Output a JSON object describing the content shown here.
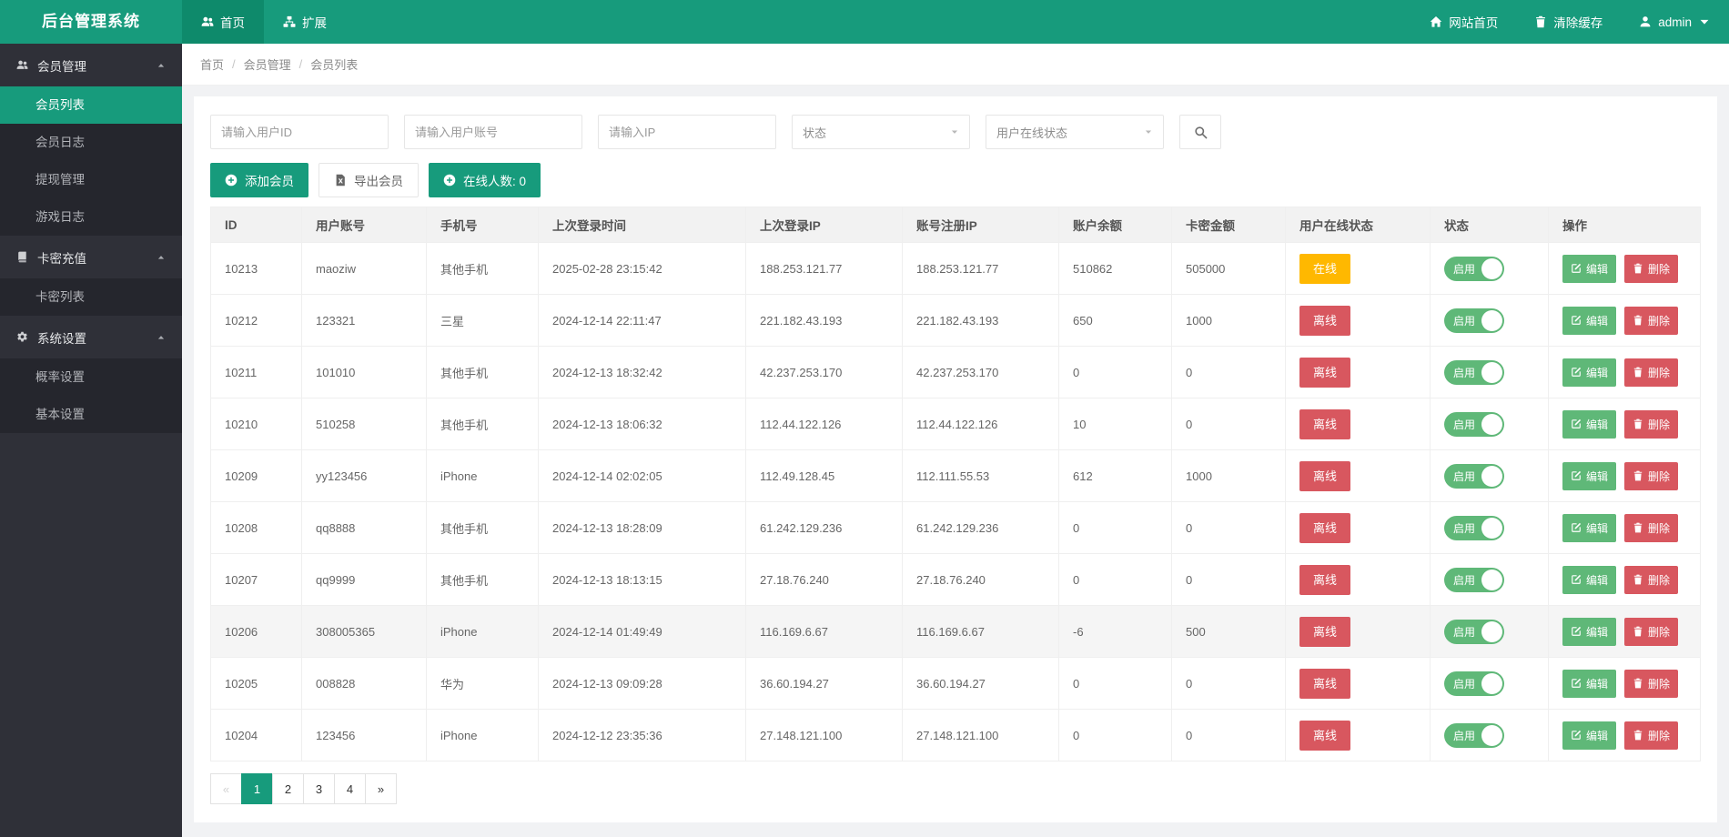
{
  "app": {
    "title": "后台管理系统"
  },
  "topnav": {
    "tabs": [
      {
        "name": "home",
        "label": "首页",
        "icon": "users-icon",
        "active": true
      },
      {
        "name": "extend",
        "label": "扩展",
        "icon": "sitemap-icon",
        "active": false
      }
    ],
    "right": [
      {
        "name": "site-home",
        "label": "网站首页",
        "icon": "home-icon",
        "caret": false
      },
      {
        "name": "clear-cache",
        "label": "清除缓存",
        "icon": "trash-icon",
        "caret": false
      },
      {
        "name": "admin-user",
        "label": "admin",
        "icon": "user-icon",
        "caret": true
      }
    ]
  },
  "sidebar": {
    "groups": [
      {
        "name": "member-management",
        "label": "会员管理",
        "icon": "users-icon",
        "expanded": true,
        "items": [
          {
            "name": "member-list",
            "label": "会员列表",
            "active": true
          },
          {
            "name": "member-log",
            "label": "会员日志",
            "active": false
          },
          {
            "name": "withdraw-management",
            "label": "提现管理",
            "active": false
          },
          {
            "name": "game-log",
            "label": "游戏日志",
            "active": false
          }
        ]
      },
      {
        "name": "card-recharge",
        "label": "卡密充值",
        "icon": "book-icon",
        "expanded": true,
        "items": [
          {
            "name": "card-list",
            "label": "卡密列表",
            "active": false
          }
        ]
      },
      {
        "name": "system-settings",
        "label": "系统设置",
        "icon": "gear-icon",
        "expanded": true,
        "items": [
          {
            "name": "probability-settings",
            "label": "概率设置",
            "active": false
          },
          {
            "name": "basic-settings",
            "label": "基本设置",
            "active": false
          }
        ]
      }
    ]
  },
  "breadcrumb": {
    "items": [
      "首页",
      "会员管理",
      "会员列表"
    ],
    "separator": "/"
  },
  "filters": {
    "inputs": [
      {
        "name": "user-id",
        "placeholder": "请输入用户ID",
        "value": ""
      },
      {
        "name": "user-account",
        "placeholder": "请输入用户账号",
        "value": ""
      },
      {
        "name": "ip",
        "placeholder": "请输入IP",
        "value": ""
      }
    ],
    "selects": [
      {
        "name": "status",
        "label": "状态"
      },
      {
        "name": "online-status",
        "label": "用户在线状态"
      }
    ]
  },
  "toolbar": {
    "add_label": "添加会员",
    "export_label": "导出会员",
    "online_count_label": "在线人数: 0"
  },
  "table": {
    "headers": [
      "ID",
      "用户账号",
      "手机号",
      "上次登录时间",
      "上次登录IP",
      "账号注册IP",
      "账户余额",
      "卡密金额",
      "用户在线状态",
      "状态",
      "操作"
    ],
    "online_badge": "在线",
    "offline_badge": "离线",
    "toggle_label": "启用",
    "edit_label": "编辑",
    "delete_label": "删除",
    "rows": [
      {
        "id": "10213",
        "account": "maoziw",
        "phone": "其他手机",
        "last_login_time": "2025-02-28 23:15:42",
        "last_login_ip": "188.253.121.77",
        "register_ip": "188.253.121.77",
        "balance": "510862",
        "card_amount": "505000",
        "online": true,
        "enabled": true,
        "highlight": false
      },
      {
        "id": "10212",
        "account": "123321",
        "phone": "三星",
        "last_login_time": "2024-12-14 22:11:47",
        "last_login_ip": "221.182.43.193",
        "register_ip": "221.182.43.193",
        "balance": "650",
        "card_amount": "1000",
        "online": false,
        "enabled": true,
        "highlight": false
      },
      {
        "id": "10211",
        "account": "101010",
        "phone": "其他手机",
        "last_login_time": "2024-12-13 18:32:42",
        "last_login_ip": "42.237.253.170",
        "register_ip": "42.237.253.170",
        "balance": "0",
        "card_amount": "0",
        "online": false,
        "enabled": true,
        "highlight": false
      },
      {
        "id": "10210",
        "account": "510258",
        "phone": "其他手机",
        "last_login_time": "2024-12-13 18:06:32",
        "last_login_ip": "112.44.122.126",
        "register_ip": "112.44.122.126",
        "balance": "10",
        "card_amount": "0",
        "online": false,
        "enabled": true,
        "highlight": false
      },
      {
        "id": "10209",
        "account": "yy123456",
        "phone": "iPhone",
        "last_login_time": "2024-12-14 02:02:05",
        "last_login_ip": "112.49.128.45",
        "register_ip": "112.111.55.53",
        "balance": "612",
        "card_amount": "1000",
        "online": false,
        "enabled": true,
        "highlight": false
      },
      {
        "id": "10208",
        "account": "qq8888",
        "phone": "其他手机",
        "last_login_time": "2024-12-13 18:28:09",
        "last_login_ip": "61.242.129.236",
        "register_ip": "61.242.129.236",
        "balance": "0",
        "card_amount": "0",
        "online": false,
        "enabled": true,
        "highlight": false
      },
      {
        "id": "10207",
        "account": "qq9999",
        "phone": "其他手机",
        "last_login_time": "2024-12-13 18:13:15",
        "last_login_ip": "27.18.76.240",
        "register_ip": "27.18.76.240",
        "balance": "0",
        "card_amount": "0",
        "online": false,
        "enabled": true,
        "highlight": false
      },
      {
        "id": "10206",
        "account": "308005365",
        "phone": "iPhone",
        "last_login_time": "2024-12-14 01:49:49",
        "last_login_ip": "116.169.6.67",
        "register_ip": "116.169.6.67",
        "balance": "-6",
        "card_amount": "500",
        "online": false,
        "enabled": true,
        "highlight": true
      },
      {
        "id": "10205",
        "account": "008828",
        "phone": "华为",
        "last_login_time": "2024-12-13 09:09:28",
        "last_login_ip": "36.60.194.27",
        "register_ip": "36.60.194.27",
        "balance": "0",
        "card_amount": "0",
        "online": false,
        "enabled": true,
        "highlight": false
      },
      {
        "id": "10204",
        "account": "123456",
        "phone": "iPhone",
        "last_login_time": "2024-12-12 23:35:36",
        "last_login_ip": "27.148.121.100",
        "register_ip": "27.148.121.100",
        "balance": "0",
        "card_amount": "0",
        "online": false,
        "enabled": true,
        "highlight": false
      }
    ]
  },
  "pagination": {
    "items": [
      "«",
      "1",
      "2",
      "3",
      "4",
      "»"
    ],
    "active": "1"
  },
  "colors": {
    "primary": "#179b7c",
    "primary_dark": "#0e8a6b",
    "sidebar_bg": "#2f3038",
    "sidebar_sub": "#25262d",
    "online_yellow": "#ffb800",
    "danger_red": "#d8575f",
    "success_green": "#5fb878"
  }
}
